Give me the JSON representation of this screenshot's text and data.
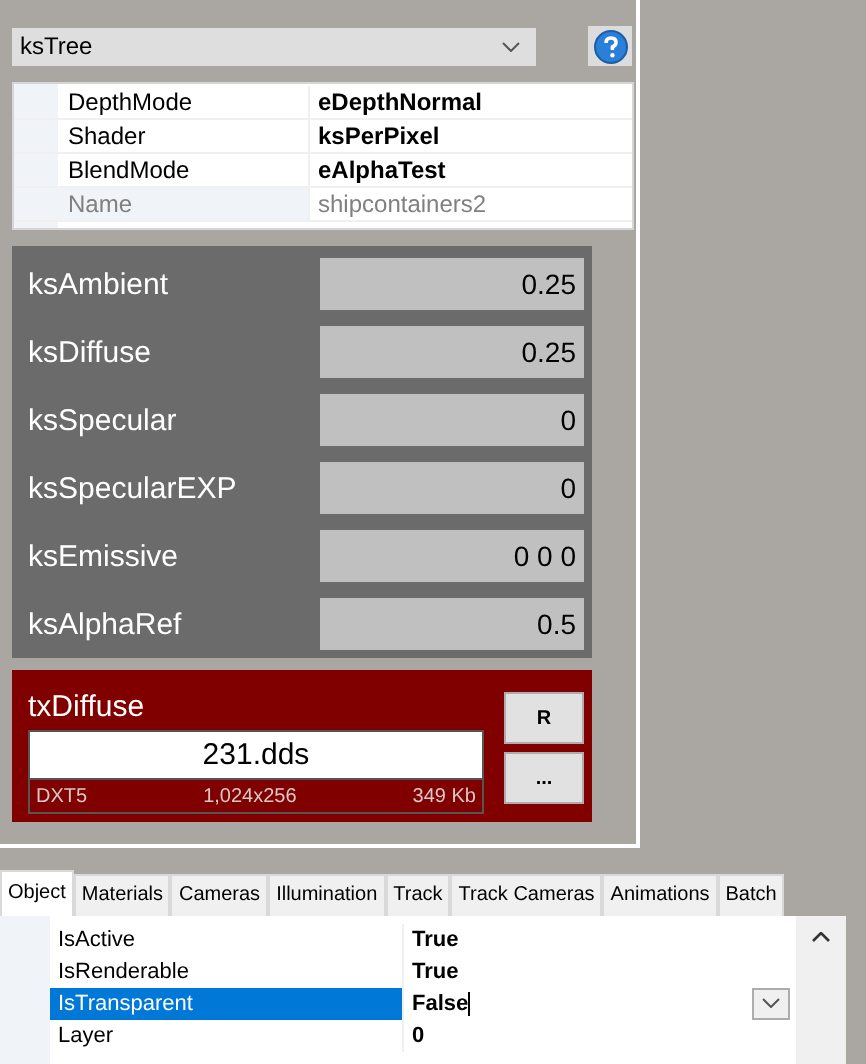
{
  "shader_select": {
    "value": "ksTree"
  },
  "material_props": [
    {
      "name": "DepthMode",
      "value": "eDepthNormal",
      "disabled": false
    },
    {
      "name": "Shader",
      "value": "ksPerPixel",
      "disabled": false
    },
    {
      "name": "BlendMode",
      "value": "eAlphaTest",
      "disabled": false
    },
    {
      "name": "Name",
      "value": "shipcontainers2",
      "disabled": true
    }
  ],
  "parameters": [
    {
      "name": "ksAmbient",
      "value": "0.25"
    },
    {
      "name": "ksDiffuse",
      "value": "0.25"
    },
    {
      "name": "ksSpecular",
      "value": "0"
    },
    {
      "name": "ksSpecularEXP",
      "value": "0"
    },
    {
      "name": "ksEmissive",
      "value": "0 0 0"
    },
    {
      "name": "ksAlphaRef",
      "value": "0.5"
    }
  ],
  "texture": {
    "name": "txDiffuse",
    "file": "231.dds",
    "format": "DXT5",
    "size": "1,024x256",
    "filesize": "349 Kb",
    "buttons": [
      "R",
      "..."
    ]
  },
  "tabs": [
    {
      "label": "Object",
      "selected": true
    },
    {
      "label": "Materials",
      "selected": false
    },
    {
      "label": "Cameras",
      "selected": false
    },
    {
      "label": "Illumination",
      "selected": false
    },
    {
      "label": "Track",
      "selected": false
    },
    {
      "label": "Track Cameras",
      "selected": false
    },
    {
      "label": "Animations",
      "selected": false
    },
    {
      "label": "Batch",
      "selected": false
    }
  ],
  "object_props": [
    {
      "name": "IsActive",
      "value": "True",
      "selected": false
    },
    {
      "name": "IsRenderable",
      "value": "True",
      "selected": false
    },
    {
      "name": "IsTransparent",
      "value": "False",
      "selected": true
    },
    {
      "name": "Layer",
      "value": "0",
      "selected": false
    }
  ]
}
